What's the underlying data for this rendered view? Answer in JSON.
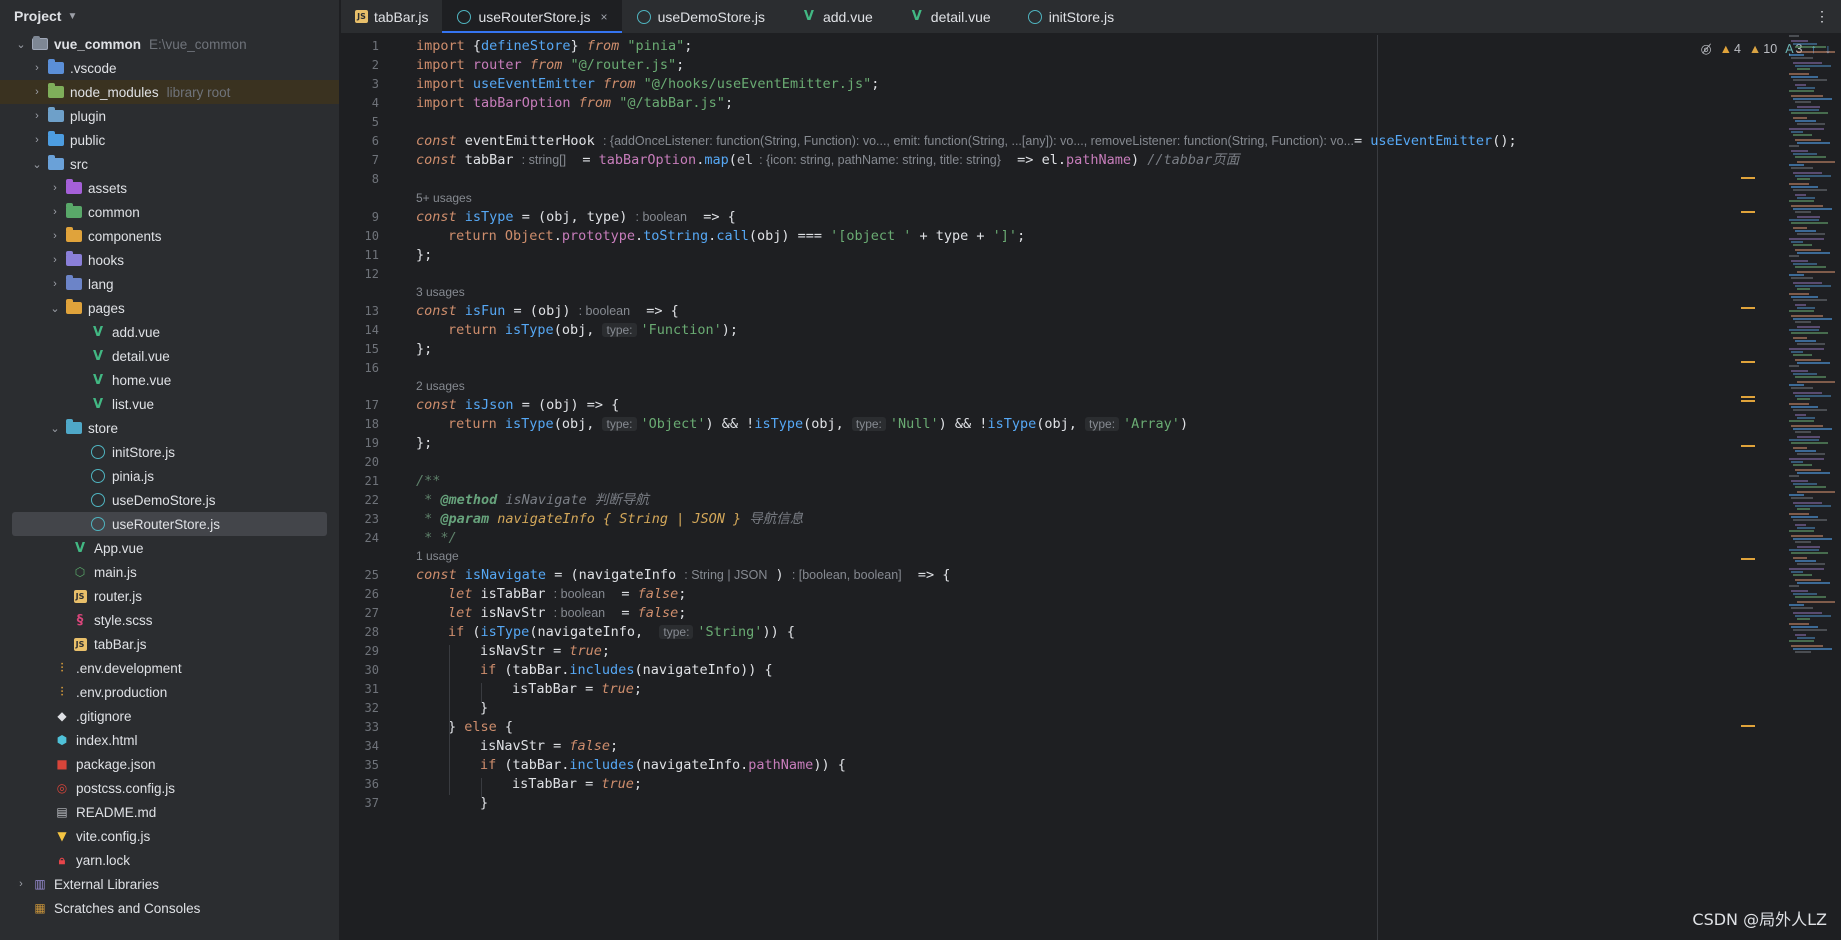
{
  "project": {
    "title": "Project",
    "root": {
      "name": "vue_common",
      "path": "E:\\vue_common"
    },
    "items": [
      {
        "name": ".vscode",
        "hint": ""
      },
      {
        "name": "node_modules",
        "hint": "library root"
      },
      {
        "name": "plugin",
        "hint": ""
      },
      {
        "name": "public",
        "hint": ""
      },
      {
        "name": "src",
        "hint": ""
      },
      {
        "name": "assets",
        "hint": ""
      },
      {
        "name": "common",
        "hint": ""
      },
      {
        "name": "components",
        "hint": ""
      },
      {
        "name": "hooks",
        "hint": ""
      },
      {
        "name": "lang",
        "hint": ""
      },
      {
        "name": "pages",
        "hint": ""
      },
      {
        "name": "add.vue",
        "hint": ""
      },
      {
        "name": "detail.vue",
        "hint": ""
      },
      {
        "name": "home.vue",
        "hint": ""
      },
      {
        "name": "list.vue",
        "hint": ""
      },
      {
        "name": "store",
        "hint": ""
      },
      {
        "name": "initStore.js",
        "hint": ""
      },
      {
        "name": "pinia.js",
        "hint": ""
      },
      {
        "name": "useDemoStore.js",
        "hint": ""
      },
      {
        "name": "useRouterStore.js",
        "hint": ""
      },
      {
        "name": "App.vue",
        "hint": ""
      },
      {
        "name": "main.js",
        "hint": ""
      },
      {
        "name": "router.js",
        "hint": ""
      },
      {
        "name": "style.scss",
        "hint": ""
      },
      {
        "name": "tabBar.js",
        "hint": ""
      },
      {
        "name": ".env.development",
        "hint": ""
      },
      {
        "name": ".env.production",
        "hint": ""
      },
      {
        "name": ".gitignore",
        "hint": ""
      },
      {
        "name": "index.html",
        "hint": ""
      },
      {
        "name": "package.json",
        "hint": ""
      },
      {
        "name": "postcss.config.js",
        "hint": ""
      },
      {
        "name": "README.md",
        "hint": ""
      },
      {
        "name": "vite.config.js",
        "hint": ""
      },
      {
        "name": "yarn.lock",
        "hint": ""
      },
      {
        "name": "External Libraries",
        "hint": ""
      },
      {
        "name": "Scratches and Consoles",
        "hint": ""
      }
    ]
  },
  "tabs": [
    {
      "label": "tabBar.js"
    },
    {
      "label": "useRouterStore.js",
      "close": "×"
    },
    {
      "label": "useDemoStore.js"
    },
    {
      "label": "add.vue"
    },
    {
      "label": "detail.vue"
    },
    {
      "label": "initStore.js"
    }
  ],
  "tab_menu": "⋮",
  "inspections": {
    "warnings": "4",
    "weak_warnings": "10",
    "typos": "3"
  },
  "line_numbers": [
    "1",
    "2",
    "3",
    "4",
    "5",
    "6",
    "7",
    "8",
    "9",
    "10",
    "11",
    "12",
    "13",
    "14",
    "15",
    "16",
    "17",
    "18",
    "19",
    "20",
    "21",
    "22",
    "23",
    "24",
    "25",
    "26",
    "27",
    "28",
    "29",
    "30",
    "31",
    "32",
    "33",
    "34",
    "35",
    "36",
    "37"
  ],
  "usages": {
    "isType": "5+ usages",
    "isFun": "3 usages",
    "isJson": "2 usages",
    "isNavigate": "1 usage"
  },
  "code": {
    "l1": [
      "import",
      " {",
      "defineStore",
      "} ",
      "from",
      " ",
      "\"pinia\"",
      ";"
    ],
    "l2": [
      "import",
      " ",
      "router",
      " ",
      "from",
      " ",
      "\"@/router.js\"",
      ";"
    ],
    "l3": [
      "import",
      " ",
      "useEventEmitter",
      " ",
      "from",
      " ",
      "\"@/hooks/useEventEmitter.js\"",
      ";"
    ],
    "l4": [
      "import",
      " ",
      "tabBarOption",
      " ",
      "from",
      " ",
      "\"@/tabBar.js\"",
      ";"
    ],
    "l6": {
      "kw": "const",
      "name": " eventEmitterHook ",
      "hint": ": {addOnceListener: function(String, Function): vo..., emit: function(String, ...[any]): vo..., removeListener: function(String, Function): vo...",
      "eq": "= ",
      "call": "useEventEmitter",
      "end": "();"
    },
    "l7": {
      "kw": "const",
      "name": " tabBar ",
      "hint": ": string[]",
      "eq": "  = ",
      "obj": "tabBarOption",
      "dot": ".",
      "fn": "map",
      "open": "(",
      "p": "el",
      "hint2": ": {icon: string, pathName: string, title: string}",
      "arrow": "  => ",
      "obj2": "el",
      "dot2": ".",
      "prop": "pathName",
      "close": ") ",
      "comment": "//tabbar页面"
    },
    "l9": {
      "kw": "const",
      "name": "isType",
      "eq": " = (",
      "p1": "obj",
      "c": ", ",
      "p2": "type",
      "close": ")",
      "hint": ": boolean",
      "arrow": "  => {"
    },
    "l10": {
      "ret": "return",
      "obj": "Object",
      "d1": ".",
      "proto": "prototype",
      "d2": ".",
      "ts": "toString",
      "d3": ".",
      "call": "call",
      "args": "(obj) === ",
      "s1": "'[object '",
      "plus": " + type + ",
      "s2": "']'",
      "end": ";"
    },
    "l11": "};",
    "l13": {
      "kw": "const",
      "name": "isFun",
      "eq": " = (",
      "p1": "obj",
      "close": ")",
      "hint": ": boolean",
      "arrow": "  => {"
    },
    "l14": {
      "ret": "return",
      "fn": "isType",
      "open": "(obj, ",
      "ph": "type:",
      "s": "'Function'",
      "end": ");"
    },
    "l15": "};",
    "l17": {
      "kw": "const",
      "name": "isJson",
      "eq": " = (",
      "p1": "obj",
      "close": ") => {"
    },
    "l18": {
      "ret": "return",
      "fn": "isType",
      "o1": "(obj, ",
      "ph1": "type:",
      "s1": "'Object'",
      "c1": ") && !",
      "fn2": "isType",
      "o2": "(obj, ",
      "ph2": "type:",
      "s2": "'Null'",
      "c2": ") && !",
      "fn3": "isType",
      "o3": "(obj, ",
      "ph3": "type:",
      "s3": "'Array'",
      "end": ")"
    },
    "l19": "};",
    "l21": "/**",
    "l22": {
      "star": " * ",
      "tag": "@method",
      "rest": " isNavigate 判断导航"
    },
    "l23": {
      "star": " * ",
      "tag": "@param",
      "type": " navigateInfo { String | JSON }",
      "rest": " 导航信息"
    },
    "l24": " * */",
    "l25": {
      "kw": "const",
      "name": "isNavigate",
      "eq": " = (",
      "p": "navigateInfo",
      "hint": ": String | JSON",
      "close": " )",
      "hint2": ": [boolean, boolean]",
      "arrow": "  => {"
    },
    "l26": {
      "kw": "let",
      "name": " isTabBar ",
      "hint": ": boolean",
      "eq": "  = ",
      "val": "false",
      "end": ";"
    },
    "l27": {
      "kw": "let",
      "name": " isNavStr ",
      "hint": ": boolean",
      "eq": "  = ",
      "val": "false",
      "end": ";"
    },
    "l28": {
      "kw": "if",
      "open": " (",
      "fn": "isType",
      "o": "(",
      "p": "navigateInfo",
      "c": ",  ",
      "ph": "type:",
      "s": "'String'",
      "end": ")) {"
    },
    "l29": {
      "name": "isNavStr = ",
      "val": "true",
      "end": ";"
    },
    "l30": {
      "kw": "if",
      "open": " (tabBar.",
      "fn": "includes",
      "o": "(",
      "p": "navigateInfo",
      "end": ")) {"
    },
    "l31": {
      "name": "isTabBar = ",
      "val": "true",
      "end": ";"
    },
    "l32": "}",
    "l33": {
      "b": "} ",
      "kw": "else",
      "end": " {"
    },
    "l34": {
      "name": "isNavStr = ",
      "val": "false",
      "end": ";"
    },
    "l35": {
      "kw": "if",
      "open": " (tabBar.",
      "fn": "includes",
      "o": "(",
      "p": "navigateInfo",
      "d": ".",
      "prop": "pathName",
      "end": ")) {"
    },
    "l36": {
      "name": "isTabBar = ",
      "val": "true",
      "end": ";"
    },
    "l37": "}"
  },
  "watermark": "CSDN @局外人LZ",
  "colors": {
    "accent": "#3574f0",
    "keyword": "#cf8e6d",
    "string": "#6aab73",
    "function": "#56a8f5",
    "property": "#c77dbb",
    "warning": "#e0a33b"
  }
}
